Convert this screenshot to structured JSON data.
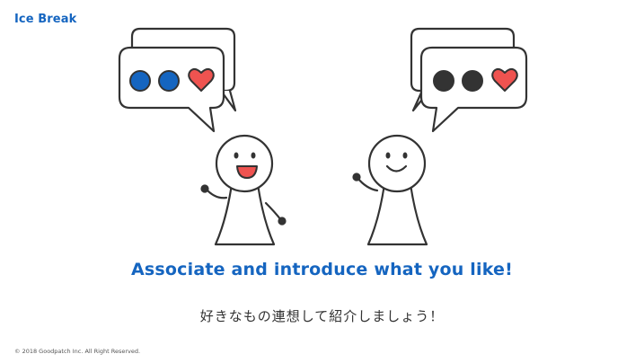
{
  "slide": {
    "section_label": "Ice Break",
    "headline": "Associate and introduce what you like!",
    "subtitle": "好きなもの連想して紹介しましょう！",
    "copyright": "© 2018 Goodpatch Inc. All Right Reserved."
  },
  "colors": {
    "accent_blue": "#1565c0",
    "heart_red": "#ef5350",
    "dot_dark": "#333333",
    "line": "#333333"
  },
  "illustration": {
    "left_person": {
      "expression": "open-mouth-smile",
      "bubble_icons": [
        "blue-dot-icon",
        "blue-dot-icon",
        "heart-icon"
      ]
    },
    "right_person": {
      "expression": "closed-smile",
      "bubble_icons": [
        "dark-dot-icon",
        "dark-dot-icon",
        "heart-icon"
      ]
    }
  }
}
